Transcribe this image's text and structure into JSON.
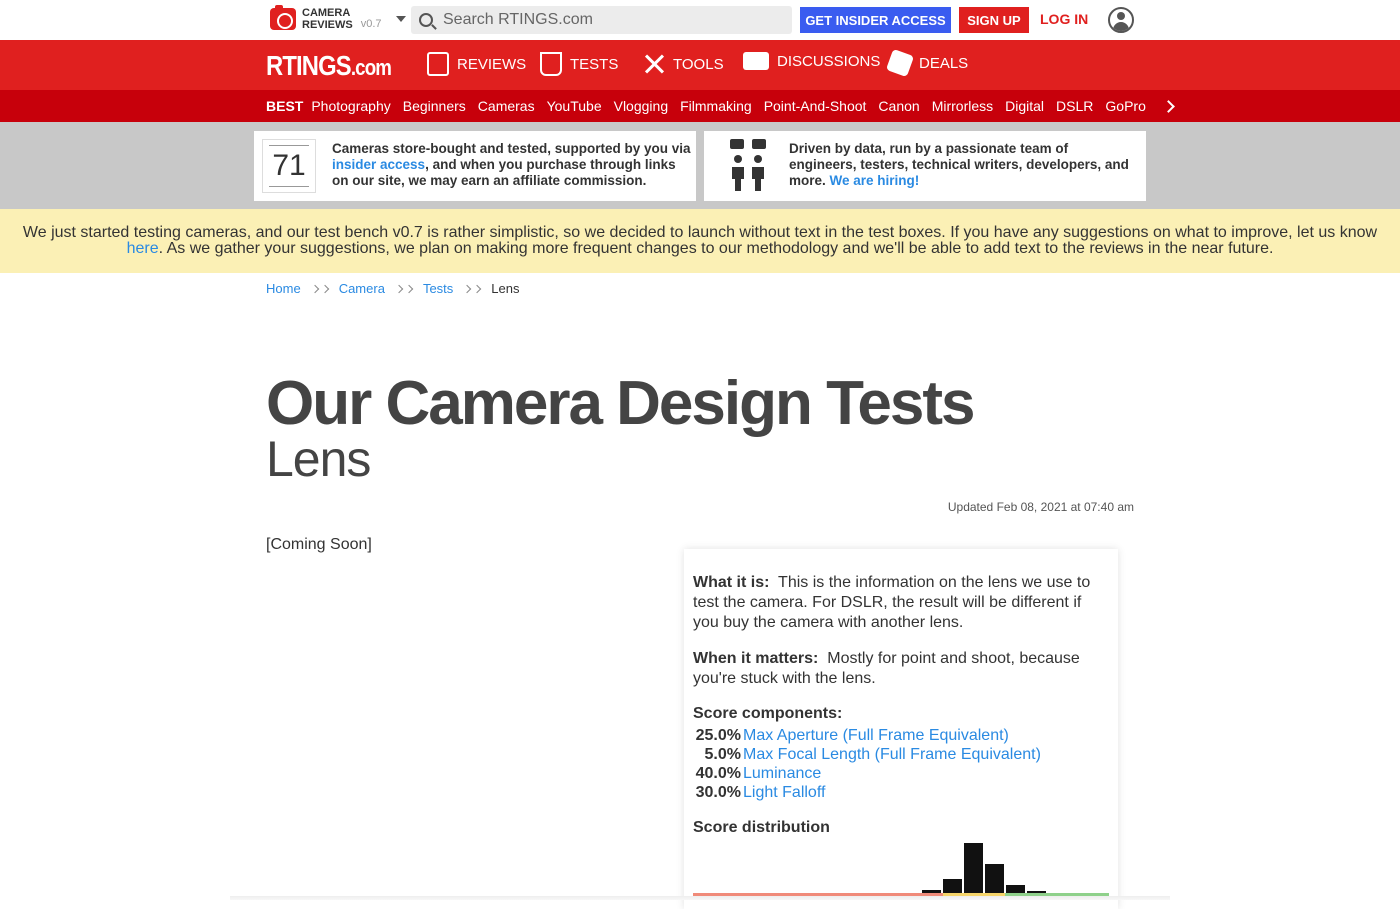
{
  "topbar": {
    "brand_line1": "CAMERA",
    "brand_line2": "REVIEWS",
    "version": "v0.7",
    "search_placeholder": "Search RTINGS.com",
    "insider_label": "GET INSIDER ACCESS",
    "signup_label": "SIGN UP",
    "login_label": "LOG IN"
  },
  "mainnav": {
    "logo": "RTINGS",
    "logo_suffix": ".com",
    "items": [
      "REVIEWS",
      "TESTS",
      "TOOLS",
      "DISCUSSIONS",
      "DEALS"
    ]
  },
  "subnav": {
    "best": "BEST",
    "items": [
      "Photography",
      "Beginners",
      "Cameras",
      "YouTube",
      "Vlogging",
      "Filmmaking",
      "Point-And-Shoot",
      "Canon",
      "Mirrorless",
      "Digital",
      "DSLR",
      "GoPro"
    ]
  },
  "banner": {
    "count": "71",
    "left_text_before": "Cameras store-bought and tested, supported by you via ",
    "left_link": "insider access",
    "left_text_after": ", and when you purchase through links on our site, we may earn an affiliate commission.",
    "right_text_before": "Driven by data, run by a passionate team of engineers, testers, technical writers, developers, and more. ",
    "right_link": "We are hiring!"
  },
  "notice": {
    "line1": "We just started testing cameras, and our test bench v0.7 is rather simplistic, so we decided to launch without text in the test boxes. If you have any suggestions on what to improve, let us know",
    "link": "here",
    "line2": ". As we gather your suggestions, we plan on making more frequent changes to our methodology and we'll be able to add text to the reviews in the near future."
  },
  "breadcrumb": [
    "Home",
    "Camera",
    "Tests",
    "Lens"
  ],
  "page": {
    "title": "Our Camera Design Tests",
    "subtitle": "Lens",
    "updated": "Updated Feb 08, 2021 at 07:40 am",
    "coming_soon": "[Coming Soon]"
  },
  "card": {
    "what_label": "What it is:",
    "what_text": "This is the information on the lens we use to test the camera. For DSLR, the result will be different if you buy the camera with another lens.",
    "when_label": "When it matters:",
    "when_text": "Mostly for point and shoot, because you're stuck with the lens.",
    "components_title": "Score components:",
    "components": [
      {
        "pct": "25.0%",
        "name": "Max Aperture (Full Frame Equivalent)"
      },
      {
        "pct": "5.0%",
        "name": "Max Focal Length (Full Frame Equivalent)"
      },
      {
        "pct": "40.0%",
        "name": "Luminance"
      },
      {
        "pct": "30.0%",
        "name": "Light Falloff"
      }
    ],
    "distribution_title": "Score distribution",
    "histogram": [
      0.06,
      0.28,
      1.0,
      0.58,
      0.16,
      0.02
    ],
    "band_colors": [
      "#f08b7a",
      "#f5d46a",
      "#8fd18b"
    ]
  }
}
